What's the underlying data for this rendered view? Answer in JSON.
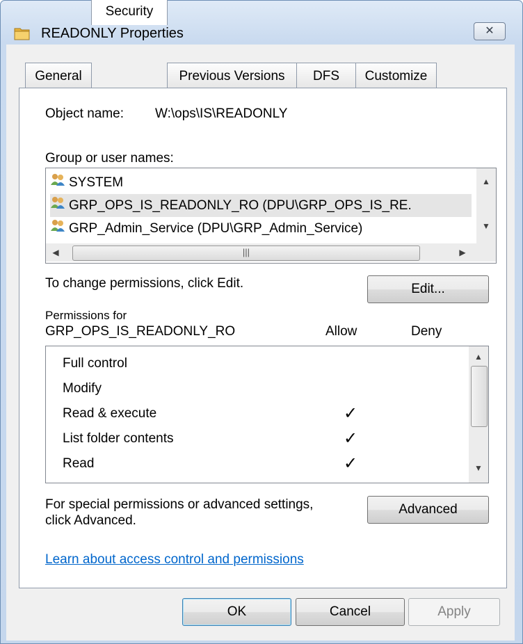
{
  "window": {
    "title": "READONLY Properties",
    "close_glyph": "✕"
  },
  "tabs": [
    {
      "label": "General",
      "active": false
    },
    {
      "label": "Security",
      "active": true
    },
    {
      "label": "Previous Versions",
      "active": false
    },
    {
      "label": "DFS",
      "active": false
    },
    {
      "label": "Customize",
      "active": false
    }
  ],
  "security": {
    "object_label": "Object name:",
    "object_value": "W:\\ops\\IS\\READONLY",
    "group_label": "Group or user names:",
    "users": [
      {
        "name": "SYSTEM",
        "selected": false
      },
      {
        "name": "GRP_OPS_IS_READONLY_RO (DPU\\GRP_OPS_IS_RE.",
        "selected": true
      },
      {
        "name": "GRP_Admin_Service (DPU\\GRP_Admin_Service)",
        "selected": false
      }
    ],
    "change_text": "To change permissions, click Edit.",
    "edit_button": "Edit...",
    "permissions_for_line1": "Permissions for",
    "permissions_for_line2": "GRP_OPS_IS_READONLY_RO",
    "allow_header": "Allow",
    "deny_header": "Deny",
    "permissions": [
      {
        "name": "Full control",
        "allow": false,
        "deny": false
      },
      {
        "name": "Modify",
        "allow": false,
        "deny": false
      },
      {
        "name": "Read & execute",
        "allow": true,
        "deny": false
      },
      {
        "name": "List folder contents",
        "allow": true,
        "deny": false
      },
      {
        "name": "Read",
        "allow": true,
        "deny": false
      }
    ],
    "check_glyph": "✓",
    "special_line1": "For special permissions or advanced settings,",
    "special_line2": "click Advanced.",
    "advanced_button": "Advanced",
    "learn_link": "Learn about access control and permissions"
  },
  "footer": {
    "ok": "OK",
    "cancel": "Cancel",
    "apply": "Apply"
  },
  "icons": {
    "folder": "folder-icon",
    "user": "users-icon"
  },
  "colors": {
    "link": "#0066cc",
    "selection": "#e5e5e5"
  }
}
